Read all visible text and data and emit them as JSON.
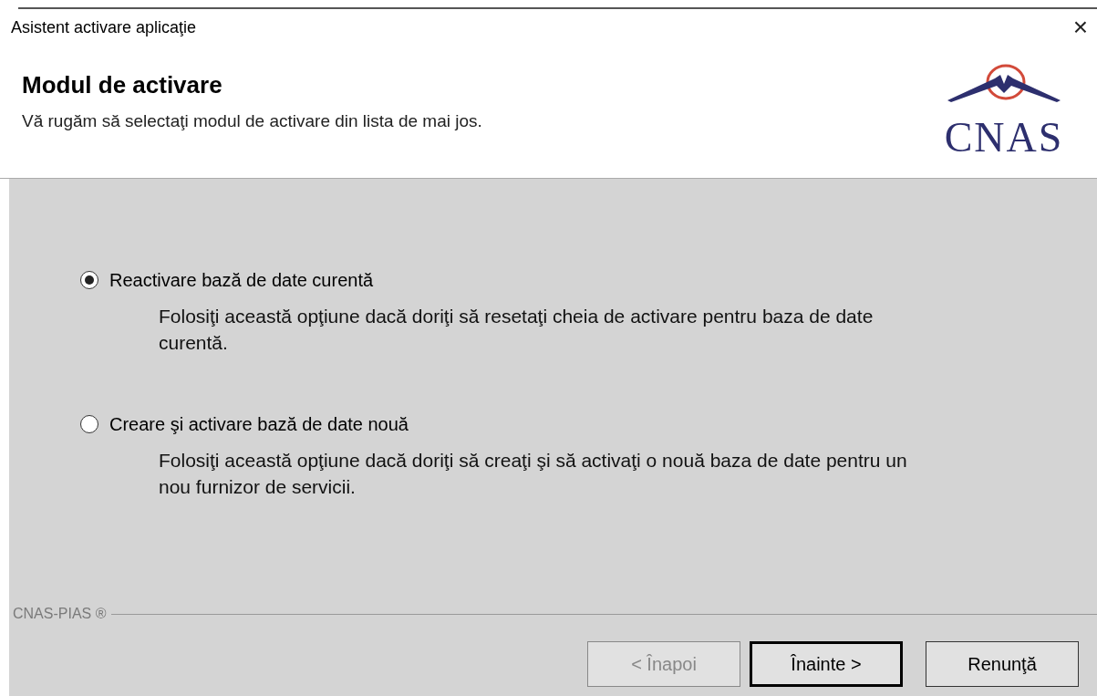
{
  "window": {
    "title": "Asistent activare aplicaţie",
    "close": "×"
  },
  "header": {
    "title": "Modul de activare",
    "subtitle": "Vă rugăm să selectaţi modul de activare din lista de mai jos.",
    "logo_text": "CNAS"
  },
  "options": [
    {
      "label": "Reactivare bază de date curentă",
      "description": "Folosiţi această opţiune dacă doriţi să resetaţi cheia de activare pentru baza de date curentă.",
      "selected": true
    },
    {
      "label": "Creare şi activare bază de date nouă",
      "description": "Folosiţi această opţiune dacă doriţi să creaţi şi să activaţi o nouă baza de date pentru un nou furnizor de servicii.",
      "selected": false
    }
  ],
  "footer": {
    "brand": "CNAS-PIAS ®"
  },
  "buttons": [
    {
      "label": "< Înapoi",
      "disabled": true,
      "default": false
    },
    {
      "label": "Înainte >",
      "disabled": false,
      "default": true
    },
    {
      "label": "Renunţă",
      "disabled": false,
      "default": false
    }
  ]
}
